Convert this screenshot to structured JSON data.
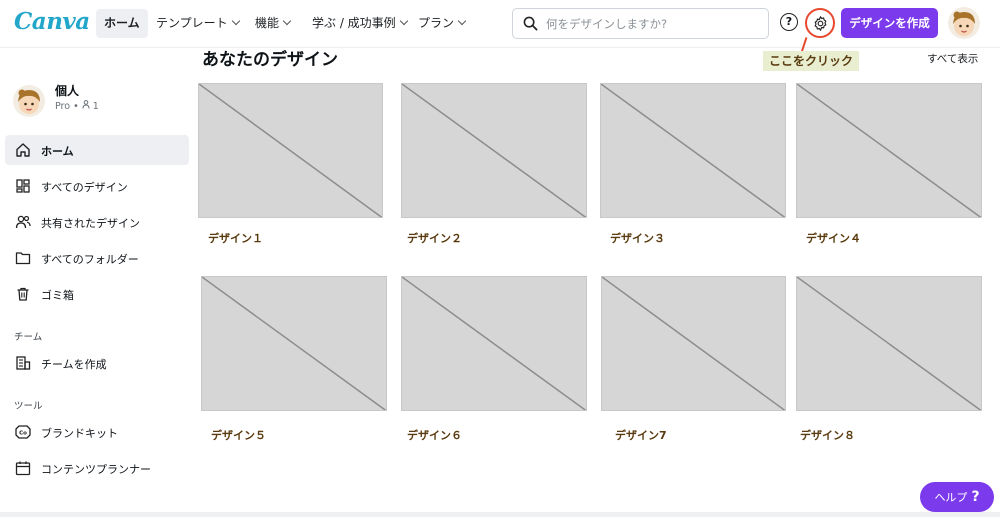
{
  "header": {
    "logo": "Canva",
    "nav": [
      {
        "label": "ホーム",
        "chevron": false,
        "active": true
      },
      {
        "label": "テンプレート",
        "chevron": true
      },
      {
        "label": "機能",
        "chevron": true
      },
      {
        "label": "学ぶ / 成功事例",
        "chevron": true
      },
      {
        "label": "プラン",
        "chevron": true
      }
    ],
    "search_placeholder": "何をデザインしますか?",
    "help_glyph": "?",
    "create_button": "デザインを作成"
  },
  "annotation": {
    "callout": "ここをクリック",
    "color": "#e8492e"
  },
  "sidebar": {
    "profile": {
      "name": "個人",
      "plan": "Pro",
      "members": "1"
    },
    "items": [
      {
        "label": "ホーム",
        "icon": "home-icon",
        "active": true
      },
      {
        "label": "すべてのデザイン",
        "icon": "grid-icon"
      },
      {
        "label": "共有されたデザイン",
        "icon": "shared-users-icon"
      },
      {
        "label": "すべてのフォルダー",
        "icon": "folder-icon"
      },
      {
        "label": "ゴミ箱",
        "icon": "trash-icon"
      }
    ],
    "section_team": "チーム",
    "team_items": [
      {
        "label": "チームを作成",
        "icon": "building-icon"
      }
    ],
    "section_tools": "ツール",
    "tool_items": [
      {
        "label": "ブランドキット",
        "icon": "brand-kit-icon"
      },
      {
        "label": "コンテンツプランナー",
        "icon": "calendar-icon"
      }
    ]
  },
  "main": {
    "title": "あなたのデザイン",
    "see_all": "すべて表示",
    "designs": [
      "デザイン１",
      "デザイン２",
      "デザイン３",
      "デザイン４",
      "デザイン５",
      "デザイン６",
      "デザイン7",
      "デザイン８"
    ]
  },
  "help_button": {
    "label": "ヘルプ",
    "glyph": "?"
  },
  "colors": {
    "accent": "#7c3aed",
    "logo": "#22a6c9",
    "callout_bg": "#e8eecf",
    "label_text": "#5a3b0f"
  }
}
